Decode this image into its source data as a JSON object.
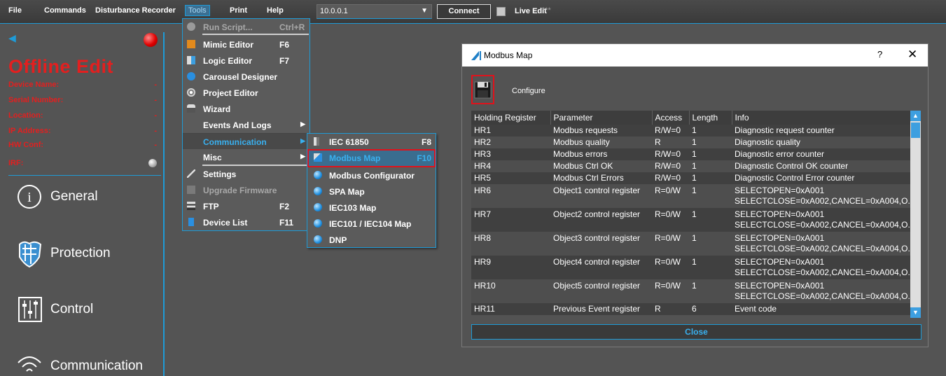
{
  "menubar": {
    "items": [
      "File",
      "Commands",
      "Disturbance Recorder",
      "Tools",
      "Print",
      "Help"
    ],
    "ip_address": "10.0.0.1",
    "connect_label": "Connect",
    "live_edit_label": "Live Edit",
    "live_edit_status": "***"
  },
  "left_panel": {
    "title": "Offline Edit",
    "device_info": [
      {
        "label": "Device Name:",
        "value": "-"
      },
      {
        "label": "Serial Number:",
        "value": "-"
      },
      {
        "label": "Location:",
        "value": "-"
      },
      {
        "label": "IP Address:",
        "value": "-"
      },
      {
        "label": "HW Conf:",
        "value": "-"
      }
    ],
    "irf_label": "IRF:",
    "nav": [
      "General",
      "Protection",
      "Control",
      "Communication"
    ]
  },
  "tools_menu": {
    "items": [
      {
        "label": "Run Script...",
        "shortcut": "Ctrl+R"
      },
      {
        "label": "Mimic Editor",
        "shortcut": "F6"
      },
      {
        "label": "Logic Editor",
        "shortcut": "F7"
      },
      {
        "label": "Carousel Designer",
        "shortcut": ""
      },
      {
        "label": "Project Editor",
        "shortcut": ""
      },
      {
        "label": "Wizard",
        "shortcut": ""
      },
      {
        "label": "Events And Logs",
        "shortcut": ""
      },
      {
        "label": "Communication",
        "shortcut": ""
      },
      {
        "label": "Misc",
        "shortcut": ""
      },
      {
        "label": "Settings",
        "shortcut": ""
      },
      {
        "label": "Upgrade Firmware",
        "shortcut": ""
      },
      {
        "label": "FTP",
        "shortcut": "F2"
      },
      {
        "label": "Device List",
        "shortcut": "F11"
      }
    ]
  },
  "communication_menu": {
    "items": [
      {
        "label": "IEC 61850",
        "shortcut": "F8"
      },
      {
        "label": "Modbus Map",
        "shortcut": "F10"
      },
      {
        "label": "Modbus Configurator",
        "shortcut": ""
      },
      {
        "label": "SPA Map",
        "shortcut": ""
      },
      {
        "label": "IEC103 Map",
        "shortcut": ""
      },
      {
        "label": "IEC101 / IEC104 Map",
        "shortcut": ""
      },
      {
        "label": "DNP",
        "shortcut": ""
      }
    ]
  },
  "dialog": {
    "title": "Modbus Map",
    "help": "?",
    "close_x": "✕",
    "configure_label": "Configure",
    "close_button": "Close",
    "columns": [
      "Holding Register",
      "Parameter",
      "Access",
      "Length",
      "Info"
    ],
    "rows": [
      {
        "reg": "HR1",
        "param": "Modbus requests",
        "access": "R/W=0",
        "length": "1",
        "info1": "Diagnostic request counter",
        "info2": ""
      },
      {
        "reg": "HR2",
        "param": "Modbus quality",
        "access": "R",
        "length": "1",
        "info1": "Diagnostic quality",
        "info2": ""
      },
      {
        "reg": "HR3",
        "param": "Modbus errors",
        "access": "R/W=0",
        "length": "1",
        "info1": "Diagnostic error counter",
        "info2": ""
      },
      {
        "reg": "HR4",
        "param": "Modbus Ctrl OK",
        "access": "R/W=0",
        "length": "1",
        "info1": "Diagnostic Control OK counter",
        "info2": ""
      },
      {
        "reg": "HR5",
        "param": "Modbus Ctrl Errors",
        "access": "R/W=0",
        "length": "1",
        "info1": "Diagnostic Control Error counter",
        "info2": ""
      },
      {
        "reg": "HR6",
        "param": "Object1 control register",
        "access": "R=0/W",
        "length": "1",
        "info1": "SELECTOPEN=0xA001",
        "info2": "SELECTCLOSE=0xA002,CANCEL=0xA004,O..."
      },
      {
        "reg": "HR7",
        "param": "Object2 control register",
        "access": "R=0/W",
        "length": "1",
        "info1": "SELECTOPEN=0xA001",
        "info2": "SELECTCLOSE=0xA002,CANCEL=0xA004,O..."
      },
      {
        "reg": "HR8",
        "param": "Object3 control register",
        "access": "R=0/W",
        "length": "1",
        "info1": "SELECTOPEN=0xA001",
        "info2": "SELECTCLOSE=0xA002,CANCEL=0xA004,O..."
      },
      {
        "reg": "HR9",
        "param": "Object4 control register",
        "access": "R=0/W",
        "length": "1",
        "info1": "SELECTOPEN=0xA001",
        "info2": "SELECTCLOSE=0xA002,CANCEL=0xA004,O..."
      },
      {
        "reg": "HR10",
        "param": "Object5 control register",
        "access": "R=0/W",
        "length": "1",
        "info1": "SELECTOPEN=0xA001",
        "info2": "SELECTCLOSE=0xA002,CANCEL=0xA004,O..."
      },
      {
        "reg": "HR11",
        "param": "Previous Event register",
        "access": "R",
        "length": "6",
        "info1": "Event code",
        "info2": ""
      }
    ]
  },
  "colors": {
    "accent": "#1e9bd7",
    "offline_red": "#e31f1f",
    "highlight_red": "#e0121b"
  }
}
